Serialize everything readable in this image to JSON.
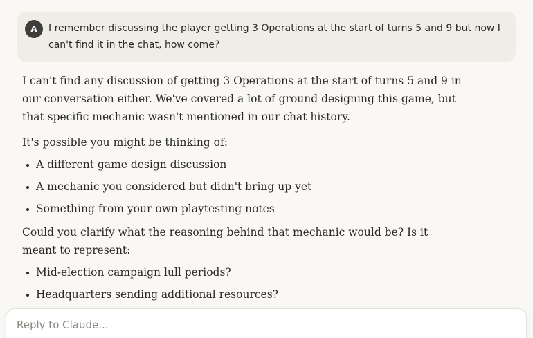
{
  "user_message": {
    "avatar_initial": "A",
    "text": "I remember discussing the player getting 3 Operations at the start of turns 5 and 9 but now I can't find it in the chat, how come?"
  },
  "assistant_message": {
    "paragraph_1": "I can't find any discussion of getting 3 Operations at the start of turns 5 and 9 in our conversation either. We've covered a lot of ground designing this game, but that specific mechanic wasn't mentioned in our chat history.",
    "paragraph_2": "It's possible you might be thinking of:",
    "list_1": [
      "A different game design discussion",
      "A mechanic you considered but didn't bring up yet",
      "Something from your own playtesting notes"
    ],
    "paragraph_3": "Could you clarify what the reasoning behind that mechanic would be? Is it meant to represent:",
    "list_2": [
      "Mid-election campaign lull periods?",
      "Headquarters sending additional resources?"
    ]
  },
  "composer": {
    "placeholder": "Reply to Claude..."
  }
}
